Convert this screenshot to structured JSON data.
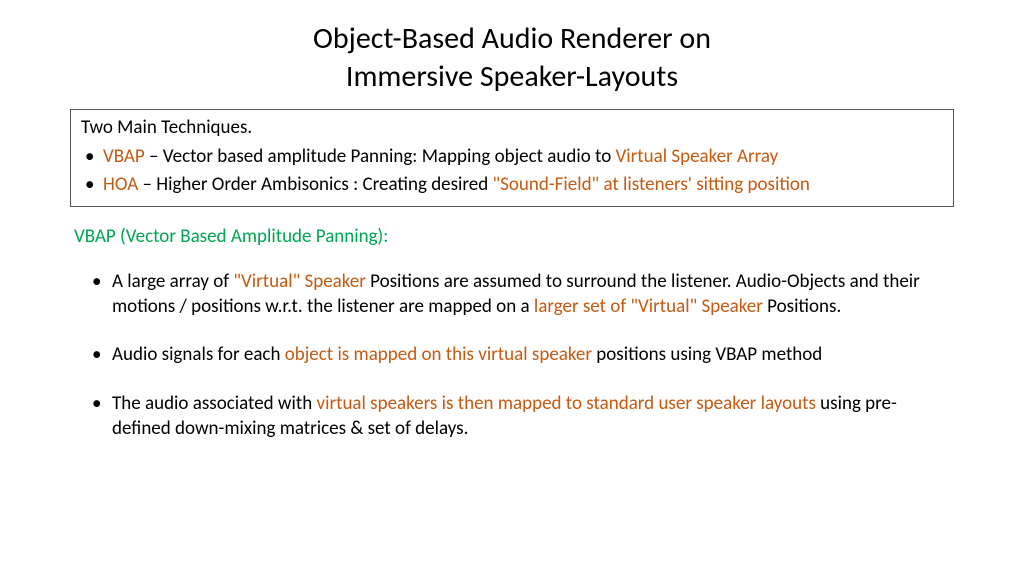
{
  "title": {
    "line1": "Object-Based Audio Renderer on",
    "line2": "Immersive Speaker-Layouts"
  },
  "box": {
    "heading": "Two Main Techniques.",
    "item1": {
      "a": "VBAP",
      "b": " – Vector based amplitude Panning:      Mapping object audio to ",
      "c": "Virtual Speaker Array"
    },
    "item2": {
      "a": "HOA",
      "b": " – Higher Order Ambisonics :       Creating desired ",
      "c": "\"Sound-Field\" at listeners' sitting position"
    }
  },
  "section_heading": "VBAP (Vector Based Amplitude Panning):",
  "bullets": {
    "b1": {
      "p1": "A large array of ",
      "p2": "\"Virtual\" Speaker",
      "p3": " Positions are assumed to surround the listener. Audio-Objects and their motions / positions w.r.t. the listener are  mapped on a ",
      "p4": "larger set of \"Virtual\" Speaker",
      "p5": " Positions."
    },
    "b2": {
      "p1": "Audio signals for each ",
      "p2": "object is mapped on this virtual speaker",
      "p3": " positions using VBAP method"
    },
    "b3": {
      "p1": "The audio associated with ",
      "p2": "virtual speakers is then mapped to standard user speaker layouts",
      "p3": " using pre-defined down-mixing matrices & set of delays."
    }
  }
}
